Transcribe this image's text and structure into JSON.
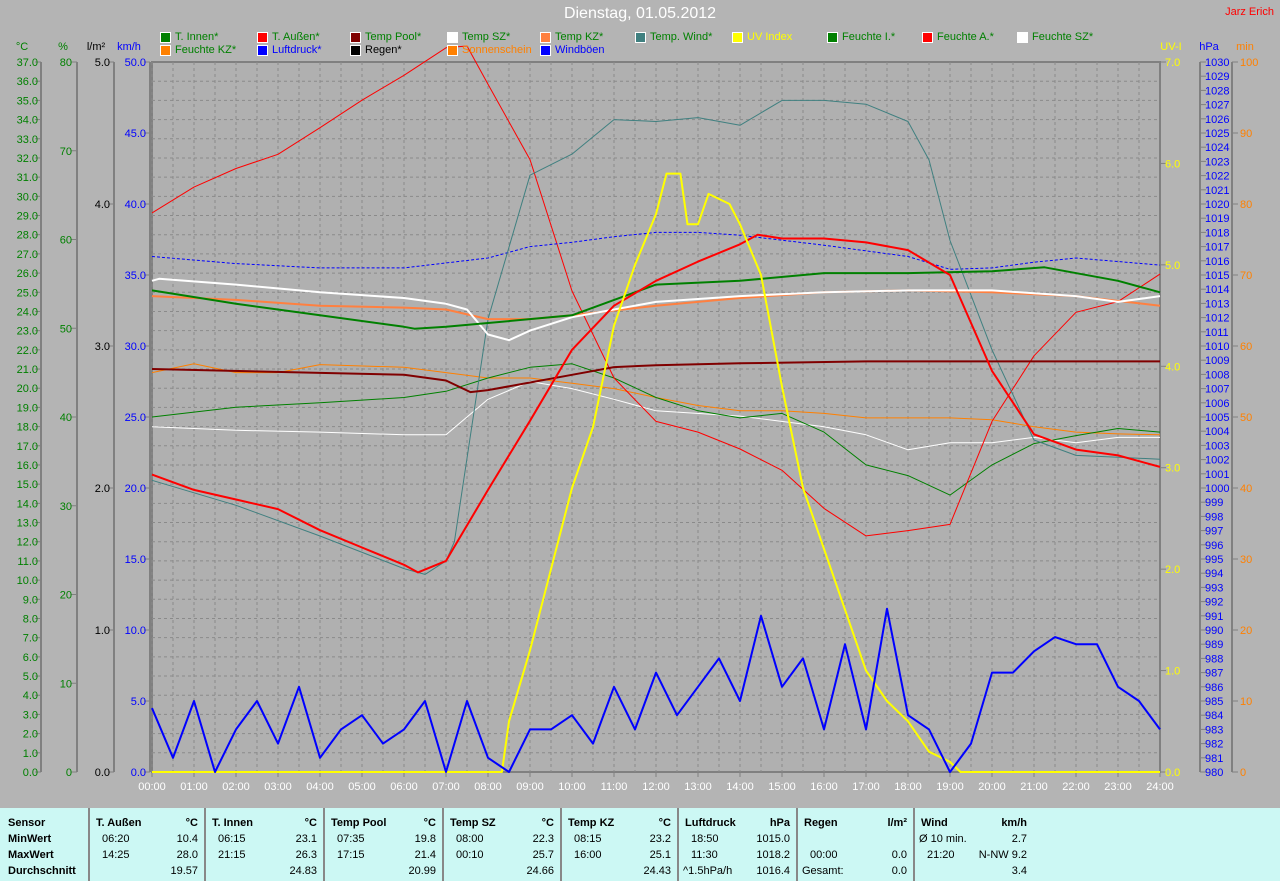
{
  "header": {
    "title": "Dienstag, 01.05.2012",
    "author": "Jarz Erich"
  },
  "legend": [
    {
      "label": "T. Innen*",
      "color": "#008000",
      "text_color": "#008000"
    },
    {
      "label": "T. Außen*",
      "color": "#ff0000",
      "text_color": "#008000"
    },
    {
      "label": "Temp Pool*",
      "color": "#800000",
      "text_color": "#008000"
    },
    {
      "label": "Temp SZ*",
      "color": "#ffffff",
      "text_color": "#008000"
    },
    {
      "label": "Temp KZ*",
      "color": "#ff8040",
      "text_color": "#008000"
    },
    {
      "label": "Temp. Wind*",
      "color": "#408080",
      "text_color": "#008000"
    },
    {
      "label": "UV Index",
      "color": "#ffff00",
      "text_color": "#ffff00"
    },
    {
      "label": "Feuchte I.*",
      "color": "#008000",
      "text_color": "#008000"
    },
    {
      "label": "Feuchte A.*",
      "color": "#ff0000",
      "text_color": "#008000"
    },
    {
      "label": "Feuchte SZ*",
      "color": "#ffffff",
      "text_color": "#008000"
    },
    {
      "label": "Feuchte KZ*",
      "color": "#ff8000",
      "text_color": "#008000"
    },
    {
      "label": "Luftdruck*",
      "color": "#0000ff",
      "text_color": "#0000ff"
    },
    {
      "label": "Regen*",
      "color": "#000000",
      "text_color": "#000000"
    },
    {
      "label": "Sonnenschein",
      "color": "#ff8000",
      "text_color": "#ff8000"
    },
    {
      "label": "Windböen",
      "color": "#0000ff",
      "text_color": "#0000ff"
    }
  ],
  "chart_data": {
    "type": "line",
    "title": "Dienstag, 01.05.2012",
    "x_ticks": [
      "00:00",
      "01:00",
      "02:00",
      "03:00",
      "04:00",
      "05:00",
      "06:00",
      "07:00",
      "08:00",
      "09:00",
      "10:00",
      "11:00",
      "12:00",
      "13:00",
      "14:00",
      "15:00",
      "16:00",
      "17:00",
      "18:00",
      "19:00",
      "20:00",
      "21:00",
      "22:00",
      "23:00",
      "24:00"
    ],
    "xlim": [
      0,
      24
    ],
    "grid": true,
    "axes": {
      "degC": {
        "title": "°C",
        "min": 0,
        "max": 37,
        "step": 1,
        "decimals": 1,
        "color": "#008000",
        "side": "left"
      },
      "pct": {
        "title": "%",
        "min": 0,
        "max": 80,
        "step": 10,
        "decimals": 0,
        "color": "#008000",
        "side": "left"
      },
      "rain": {
        "title": "l/m²",
        "min": 0,
        "max": 5,
        "step": 1,
        "decimals": 1,
        "color": "#000000",
        "side": "left"
      },
      "kmh": {
        "title": "km/h",
        "min": 0,
        "max": 50,
        "step": 5,
        "decimals": 1,
        "color": "#0000ff",
        "side": "left"
      },
      "uv": {
        "title": "UV-I",
        "min": 0,
        "max": 7,
        "step": 1,
        "decimals": 1,
        "color": "#ffff00",
        "side": "right"
      },
      "hpa": {
        "title": "hPa",
        "min": 980,
        "max": 1030,
        "step": 1,
        "decimals": 0,
        "color": "#0000ff",
        "side": "right"
      },
      "min": {
        "title": "min",
        "min": 0,
        "max": 100,
        "step": 10,
        "decimals": 0,
        "color": "#ff8000",
        "side": "right"
      }
    },
    "series": [
      {
        "name": "Feuchte KZ",
        "axis": "pct",
        "color": "#ff8000",
        "width": 1,
        "x": [
          0,
          1,
          2,
          3,
          4,
          6,
          7,
          8,
          9,
          10,
          11,
          12,
          13,
          14,
          15,
          16,
          17,
          18,
          19,
          20,
          21,
          22,
          23,
          24
        ],
        "y": [
          45,
          46,
          45,
          45,
          45.9,
          45.6,
          45,
          44.4,
          44.4,
          43.8,
          43.2,
          42.2,
          41.3,
          40.7,
          40.7,
          40.4,
          39.9,
          39.9,
          39.9,
          39.7,
          38.9,
          38.3,
          38.1,
          38
        ]
      },
      {
        "name": "Feuchte SZ",
        "axis": "pct",
        "color": "#ffffff",
        "width": 1,
        "x": [
          0,
          2,
          4,
          6,
          7,
          8,
          9,
          10,
          11,
          12,
          14,
          16,
          17,
          18,
          19,
          20,
          21,
          22,
          23,
          24
        ],
        "y": [
          38.9,
          38.5,
          38.3,
          38,
          38,
          42,
          44,
          43.2,
          42,
          40.7,
          40.1,
          38.9,
          38,
          36.3,
          37.1,
          37.1,
          37.7,
          37.1,
          37.7,
          37.7
        ]
      },
      {
        "name": "Feuchte I.",
        "axis": "pct",
        "color": "#008000",
        "width": 1,
        "x": [
          0,
          2,
          4,
          6,
          7,
          8,
          9,
          10,
          11,
          12,
          13,
          14,
          15,
          16,
          17,
          18,
          19,
          20,
          21,
          22,
          23,
          24
        ],
        "y": [
          40,
          41.1,
          41.6,
          42.2,
          42.9,
          44.4,
          45.6,
          46,
          44.4,
          42.2,
          40.7,
          39.9,
          40.4,
          38.3,
          34.6,
          33.4,
          31.2,
          34.6,
          37,
          37.9,
          38.7,
          38.3
        ]
      },
      {
        "name": "Feuchte A.",
        "axis": "pct",
        "color": "#ff0000",
        "width": 1,
        "x": [
          0,
          1,
          2,
          3,
          4,
          5,
          6,
          7,
          7.5,
          8,
          9,
          10,
          11,
          12,
          13,
          14,
          15,
          16,
          17,
          18,
          19,
          20,
          21,
          22,
          23,
          24
        ],
        "y": [
          63,
          65.9,
          68,
          69.6,
          72.6,
          75.7,
          78.5,
          81.6,
          81.8,
          77.5,
          69,
          54.2,
          44.4,
          39.5,
          38.3,
          36.4,
          34,
          29.7,
          26.6,
          27.2,
          27.9,
          39.5,
          46.9,
          51.8,
          53,
          56.1
        ]
      },
      {
        "name": "Luftdruck",
        "axis": "hpa",
        "color": "#0000ff",
        "width": 1,
        "dash": true,
        "x": [
          0,
          2,
          4,
          6,
          8,
          9,
          10,
          11,
          12,
          13,
          14,
          16,
          18,
          19,
          20,
          21,
          22,
          24
        ],
        "y": [
          1016.3,
          1015.8,
          1015.5,
          1015.5,
          1016.2,
          1017,
          1017.3,
          1017.7,
          1018,
          1018,
          1017.8,
          1017.1,
          1016.3,
          1015.4,
          1015.5,
          1015.9,
          1016.2,
          1015.7
        ]
      },
      {
        "name": "Temp. Wind",
        "axis": "degC",
        "color": "#408080",
        "width": 1,
        "x": [
          0,
          2,
          4,
          6,
          6.5,
          7,
          7.2,
          8,
          9,
          10,
          11,
          12,
          13,
          14,
          15,
          16,
          17,
          18,
          18.5,
          19,
          20,
          21,
          22,
          23,
          24
        ],
        "y": [
          15.2,
          13.9,
          12.3,
          10.6,
          10.3,
          11,
          12,
          23.6,
          31.1,
          32.2,
          34,
          33.9,
          34.1,
          33.7,
          35,
          35,
          34.8,
          33.9,
          31.9,
          27.7,
          22,
          17.3,
          16.5,
          16.4,
          16.3
        ]
      },
      {
        "name": "Temp Pool",
        "axis": "degC",
        "color": "#800000",
        "width": 2,
        "x": [
          0,
          4,
          6,
          7,
          7.58,
          8,
          9,
          10,
          11,
          12,
          14,
          17,
          20,
          24
        ],
        "y": [
          21,
          20.8,
          20.7,
          20.4,
          19.8,
          19.9,
          20.3,
          20.7,
          21.1,
          21.2,
          21.3,
          21.4,
          21.4,
          21.4
        ]
      },
      {
        "name": "Temp KZ",
        "axis": "degC",
        "color": "#ff8040",
        "width": 2,
        "x": [
          0,
          2,
          4,
          6,
          7,
          8,
          9,
          10,
          12,
          14,
          16,
          18,
          20,
          22,
          24
        ],
        "y": [
          24.8,
          24.6,
          24.3,
          24.2,
          24.1,
          23.6,
          23.6,
          23.8,
          24.3,
          24.7,
          25,
          25.1,
          25,
          24.8,
          24.3
        ]
      },
      {
        "name": "Temp SZ",
        "axis": "degC",
        "color": "#ffffff",
        "width": 2,
        "x": [
          0,
          0.17,
          2,
          4,
          6,
          7,
          7.5,
          8,
          8.5,
          9,
          10,
          11,
          12,
          14,
          16,
          18,
          20,
          22,
          23,
          24
        ],
        "y": [
          25.6,
          25.7,
          25.4,
          25,
          24.7,
          24.4,
          24.1,
          22.8,
          22.5,
          23,
          23.7,
          24.1,
          24.5,
          24.8,
          25,
          25.1,
          25.1,
          24.8,
          24.5,
          24.8
        ]
      },
      {
        "name": "T. Innen",
        "axis": "degC",
        "color": "#008000",
        "width": 2,
        "x": [
          0,
          2,
          4,
          6,
          6.25,
          7,
          8,
          10,
          12,
          14,
          16,
          18,
          20,
          21.25,
          23,
          24
        ],
        "y": [
          25.1,
          24.4,
          23.8,
          23.2,
          23.1,
          23.2,
          23.4,
          23.8,
          25.4,
          25.6,
          26,
          26,
          26.1,
          26.3,
          25.6,
          25
        ]
      },
      {
        "name": "T. Außen",
        "axis": "degC",
        "color": "#ff0000",
        "width": 2,
        "x": [
          0,
          1,
          2,
          3,
          4,
          5,
          6,
          6.33,
          7,
          8,
          9,
          10,
          11,
          12,
          13,
          14,
          14.42,
          15,
          16,
          17,
          18,
          19,
          20,
          21,
          22,
          23,
          24
        ],
        "y": [
          15.5,
          14.7,
          14.2,
          13.7,
          12.6,
          11.7,
          10.8,
          10.4,
          11,
          14.7,
          18.3,
          22,
          24.3,
          25.6,
          26.6,
          27.5,
          28,
          27.8,
          27.8,
          27.6,
          27.2,
          25.9,
          20.9,
          17.6,
          16.8,
          16.5,
          15.9
        ]
      },
      {
        "name": "UV Index",
        "axis": "uv",
        "color": "#ffff00",
        "width": 2,
        "x": [
          0,
          8.33,
          8.5,
          9,
          9.5,
          10,
          10.5,
          11,
          11.5,
          12,
          12.25,
          12.58,
          12.75,
          13,
          13.25,
          13.75,
          14,
          14.5,
          15,
          15.5,
          16,
          16.5,
          17,
          17.5,
          18,
          18.5,
          19,
          19.25,
          24
        ],
        "y": [
          0,
          0,
          0.5,
          1.2,
          2,
          2.8,
          3.4,
          4.4,
          5,
          5.5,
          5.9,
          5.9,
          5.4,
          5.4,
          5.7,
          5.6,
          5.4,
          4.9,
          3.8,
          2.8,
          2.2,
          1.6,
          1,
          0.7,
          0.5,
          0.2,
          0.1,
          0,
          0
        ]
      },
      {
        "name": "Windböen",
        "axis": "kmh",
        "color": "#0000ff",
        "width": 2,
        "x": [
          0,
          0.5,
          1,
          1.5,
          2,
          2.5,
          3,
          3.5,
          4,
          4.5,
          5,
          5.5,
          6,
          6.5,
          7,
          7.5,
          8,
          8.5,
          9,
          9.5,
          10,
          10.5,
          11,
          11.5,
          12,
          12.5,
          13,
          13.5,
          14,
          14.5,
          15,
          15.5,
          16,
          16.5,
          17,
          17.5,
          18,
          18.5,
          19,
          19.5,
          20,
          20.5,
          21,
          21.5,
          22,
          22.5,
          23,
          23.5,
          24
        ],
        "y": [
          4.5,
          1,
          5,
          0,
          3,
          5,
          2,
          6,
          1,
          3,
          4,
          2,
          3,
          5,
          0,
          5,
          1,
          0,
          3,
          3,
          4,
          2,
          6,
          3,
          7,
          4,
          6,
          8,
          5,
          11,
          6,
          8,
          3,
          9,
          3,
          11.5,
          4,
          3,
          0,
          2,
          7,
          7,
          8.5,
          9.5,
          9,
          9,
          6,
          5,
          3
        ]
      }
    ]
  },
  "table": {
    "row_labels": [
      "Sensor",
      "MinWert",
      "MaxWert",
      "Durchschnitt"
    ],
    "columns": [
      {
        "header": "T. Außen",
        "unit": "°C",
        "min_time": "06:20",
        "min": "10.4",
        "max_time": "14:25",
        "max": "28.0",
        "avg_label": "",
        "avg": "19.57"
      },
      {
        "header": "T. Innen",
        "unit": "°C",
        "min_time": "06:15",
        "min": "23.1",
        "max_time": "21:15",
        "max": "26.3",
        "avg_label": "",
        "avg": "24.83"
      },
      {
        "header": "Temp Pool",
        "unit": "°C",
        "min_time": "07:35",
        "min": "19.8",
        "max_time": "17:15",
        "max": "21.4",
        "avg_label": "",
        "avg": "20.99"
      },
      {
        "header": "Temp SZ",
        "unit": "°C",
        "min_time": "08:00",
        "min": "22.3",
        "max_time": "00:10",
        "max": "25.7",
        "avg_label": "",
        "avg": "24.66"
      },
      {
        "header": "Temp KZ",
        "unit": "°C",
        "min_time": "08:15",
        "min": "23.2",
        "max_time": "16:00",
        "max": "25.1",
        "avg_label": "",
        "avg": "24.43"
      },
      {
        "header": "Luftdruck",
        "unit": "hPa",
        "min_time": "18:50",
        "min": "1015.0",
        "max_time": "11:30",
        "max": "1018.2",
        "avg_label": "^1.5hPa/h",
        "avg": "1016.4"
      },
      {
        "header": "Regen",
        "unit": "l/m²",
        "min_time": "",
        "min": "",
        "max_time": "00:00",
        "max": "0.0",
        "avg_label": "Gesamt:",
        "avg": "0.0"
      },
      {
        "header": "Wind",
        "unit": "km/h",
        "min_time": "Ø 10 min.",
        "min": "2.7",
        "max_time": "21:20",
        "max": "N-NW 9.2",
        "avg_label": "",
        "avg": "3.4"
      }
    ]
  }
}
